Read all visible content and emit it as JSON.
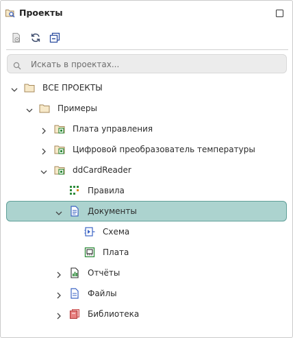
{
  "panel": {
    "title": "Проекты"
  },
  "search": {
    "placeholder": "Искать в проектах...",
    "value": ""
  },
  "tree": {
    "all_projects": "ВСЕ ПРОЕКТЫ",
    "examples": "Примеры",
    "control_board": "Плата управления",
    "temp_converter": "Цифровой преобразователь температуры",
    "ddcardreader": "ddCardReader",
    "rules": "Правила",
    "documents": "Документы",
    "schema": "Схема",
    "board": "Плата",
    "reports": "Отчёты",
    "files": "Файлы",
    "library": "Библиотека"
  },
  "colors": {
    "selection_bg": "#acd3cf",
    "selection_border": "#5f9f98",
    "folder": "#f7e9c9",
    "green": "#2e8b3a",
    "blue": "#3b63c4",
    "red": "#c94a4a"
  }
}
